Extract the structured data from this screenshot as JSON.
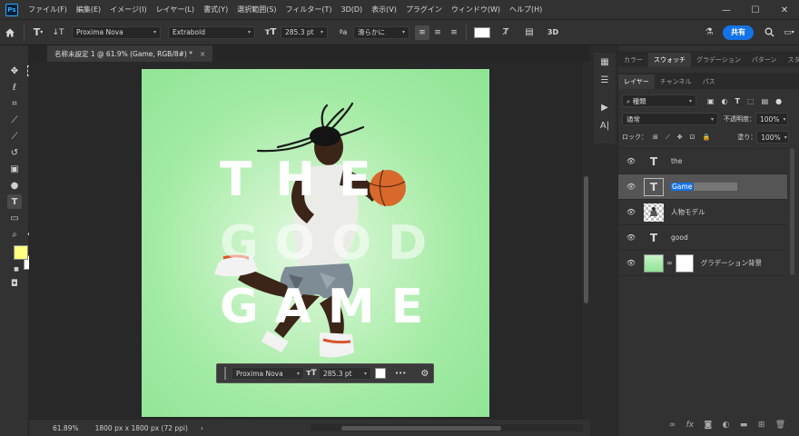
{
  "menubar": {
    "items": [
      "ファイル(F)",
      "編集(E)",
      "イメージ(I)",
      "レイヤー(L)",
      "書式(Y)",
      "選択範囲(S)",
      "フィルター(T)",
      "3D(D)",
      "表示(V)",
      "プラグイン",
      "ウィンドウ(W)",
      "ヘルプ(H)"
    ],
    "logo": "Ps"
  },
  "window_controls": {
    "minimize": "—",
    "maximize": "☐",
    "close": "✕"
  },
  "options": {
    "font_family": "Proxima Nova",
    "font_style": "Extrabold",
    "font_size": "285.3 pt",
    "antialias": "滑らかに",
    "three_d": "3D",
    "share": "共有"
  },
  "document": {
    "tab_title": "名称未設定 1 @ 61.9% (Game, RGB/8#) *",
    "close": "×",
    "words": [
      "THE",
      "GOOD",
      "GAME"
    ]
  },
  "floating_bar": {
    "font": "Proxima Nova",
    "size": "285.3 pt",
    "more": "•••"
  },
  "status": {
    "zoom": "61.89%",
    "doc_size": "1800 px x 1800 px (72 ppi)",
    "arrow": "›"
  },
  "panels": {
    "top_tabs": [
      "カラー",
      "スウォッチ",
      "グラデーション",
      "パターン",
      "スタイル"
    ],
    "top_active": 1,
    "layer_tabs": [
      "レイヤー",
      "チャンネル",
      "パス"
    ],
    "layer_active": 0,
    "filter_kind": "種類",
    "blend_mode": "通常",
    "opacity_label": "不透明度：",
    "opacity_value": "100%",
    "lock_label": "ロック：",
    "fill_label": "塗り：",
    "fill_value": "100%"
  },
  "layers": [
    {
      "name": "the",
      "kind": "text",
      "selected": false
    },
    {
      "name": "Game",
      "kind": "text",
      "selected": true
    },
    {
      "name": "人物モデル",
      "kind": "image",
      "selected": false
    },
    {
      "name": "good",
      "kind": "text",
      "selected": false
    },
    {
      "name": "グラデーション背景",
      "kind": "fill",
      "selected": false
    }
  ],
  "colors": {
    "foreground": "#ffff80",
    "background": "#ffffff",
    "canvas_green": "#8fe495",
    "accent_blue": "#1473e6"
  }
}
